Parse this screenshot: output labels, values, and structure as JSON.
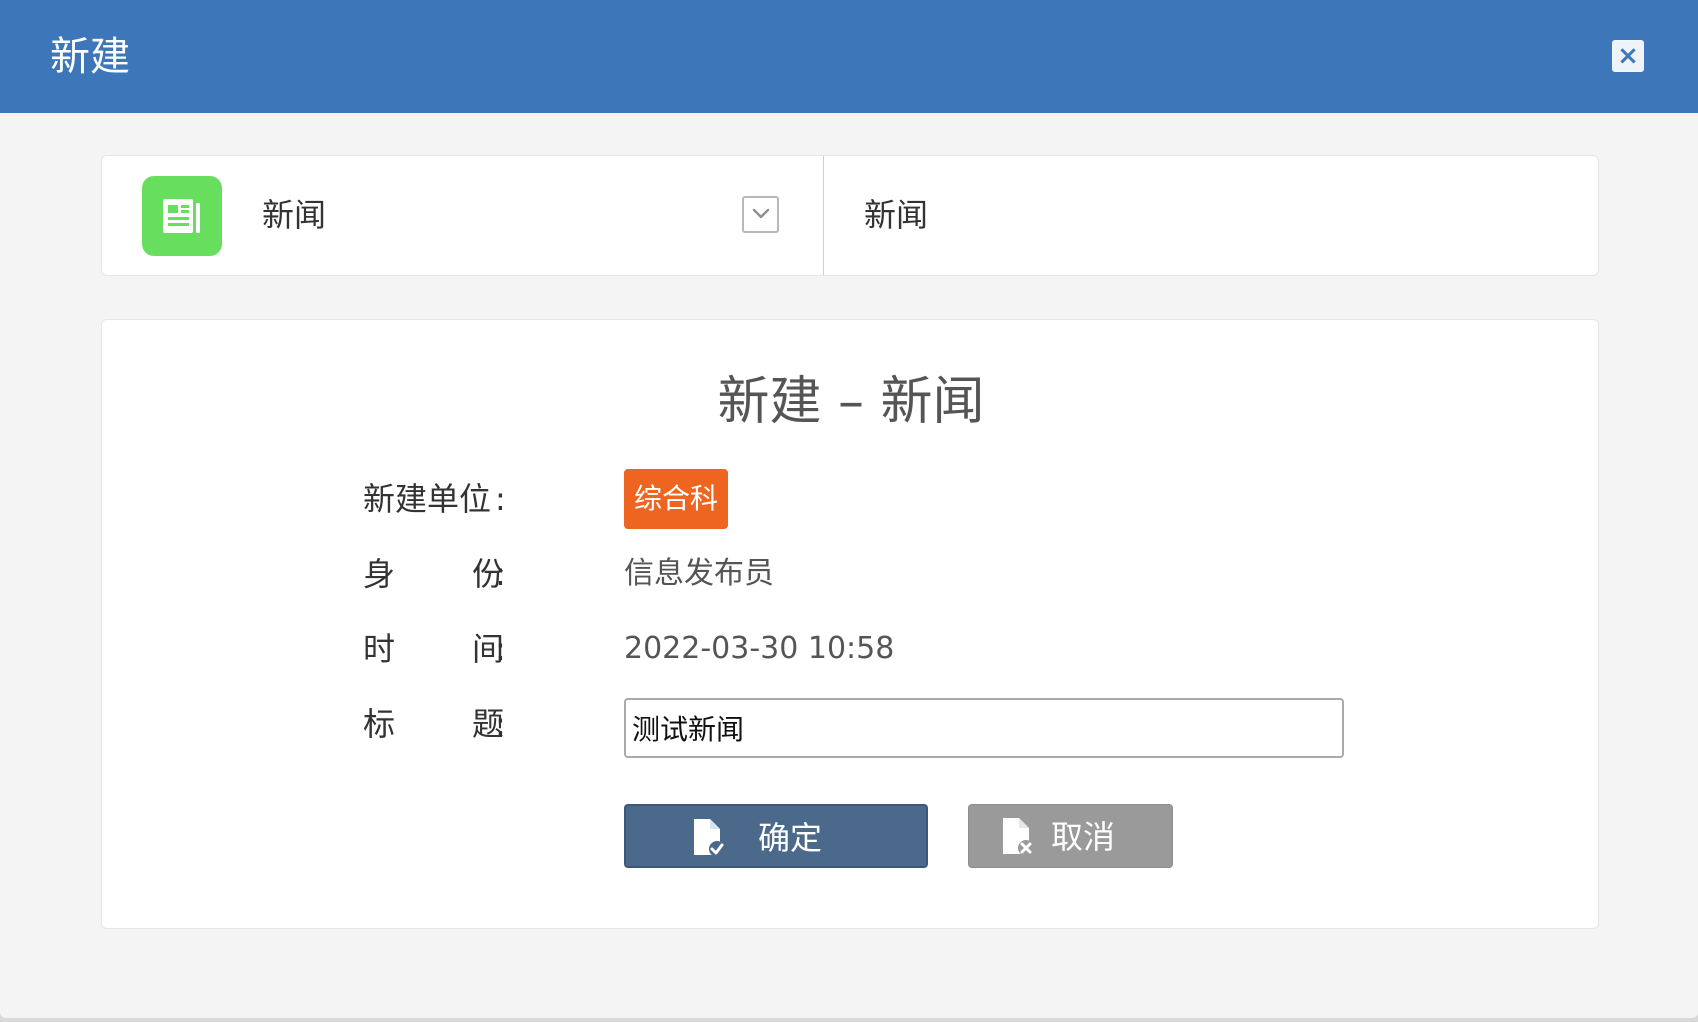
{
  "dialog": {
    "title": "新建",
    "close_label": "×",
    "header_color": "#3d77b9"
  },
  "type_selector": {
    "icon": "news-icon",
    "selected_label": "新闻",
    "dropdown_icon": "chevron-down-icon",
    "current_type": "新闻"
  },
  "form": {
    "heading": "新建 – 新闻",
    "fields": [
      {
        "label": "新建单位",
        "colon": ":",
        "value": "综合科"
      },
      {
        "label": [
          "身",
          "份"
        ],
        "colon": ":",
        "value": "信息发布员"
      },
      {
        "label": [
          "时",
          "间"
        ],
        "colon": ":",
        "value": "2022-03-30 10:58"
      },
      {
        "label": [
          "标",
          "题"
        ],
        "colon": ":",
        "value": "测试新闻"
      }
    ],
    "badge_color": "#ee6522"
  },
  "actions": {
    "confirm_label": "确定",
    "confirm_icon": "document-check-icon",
    "cancel_label": "取消",
    "cancel_icon": "document-x-icon"
  }
}
